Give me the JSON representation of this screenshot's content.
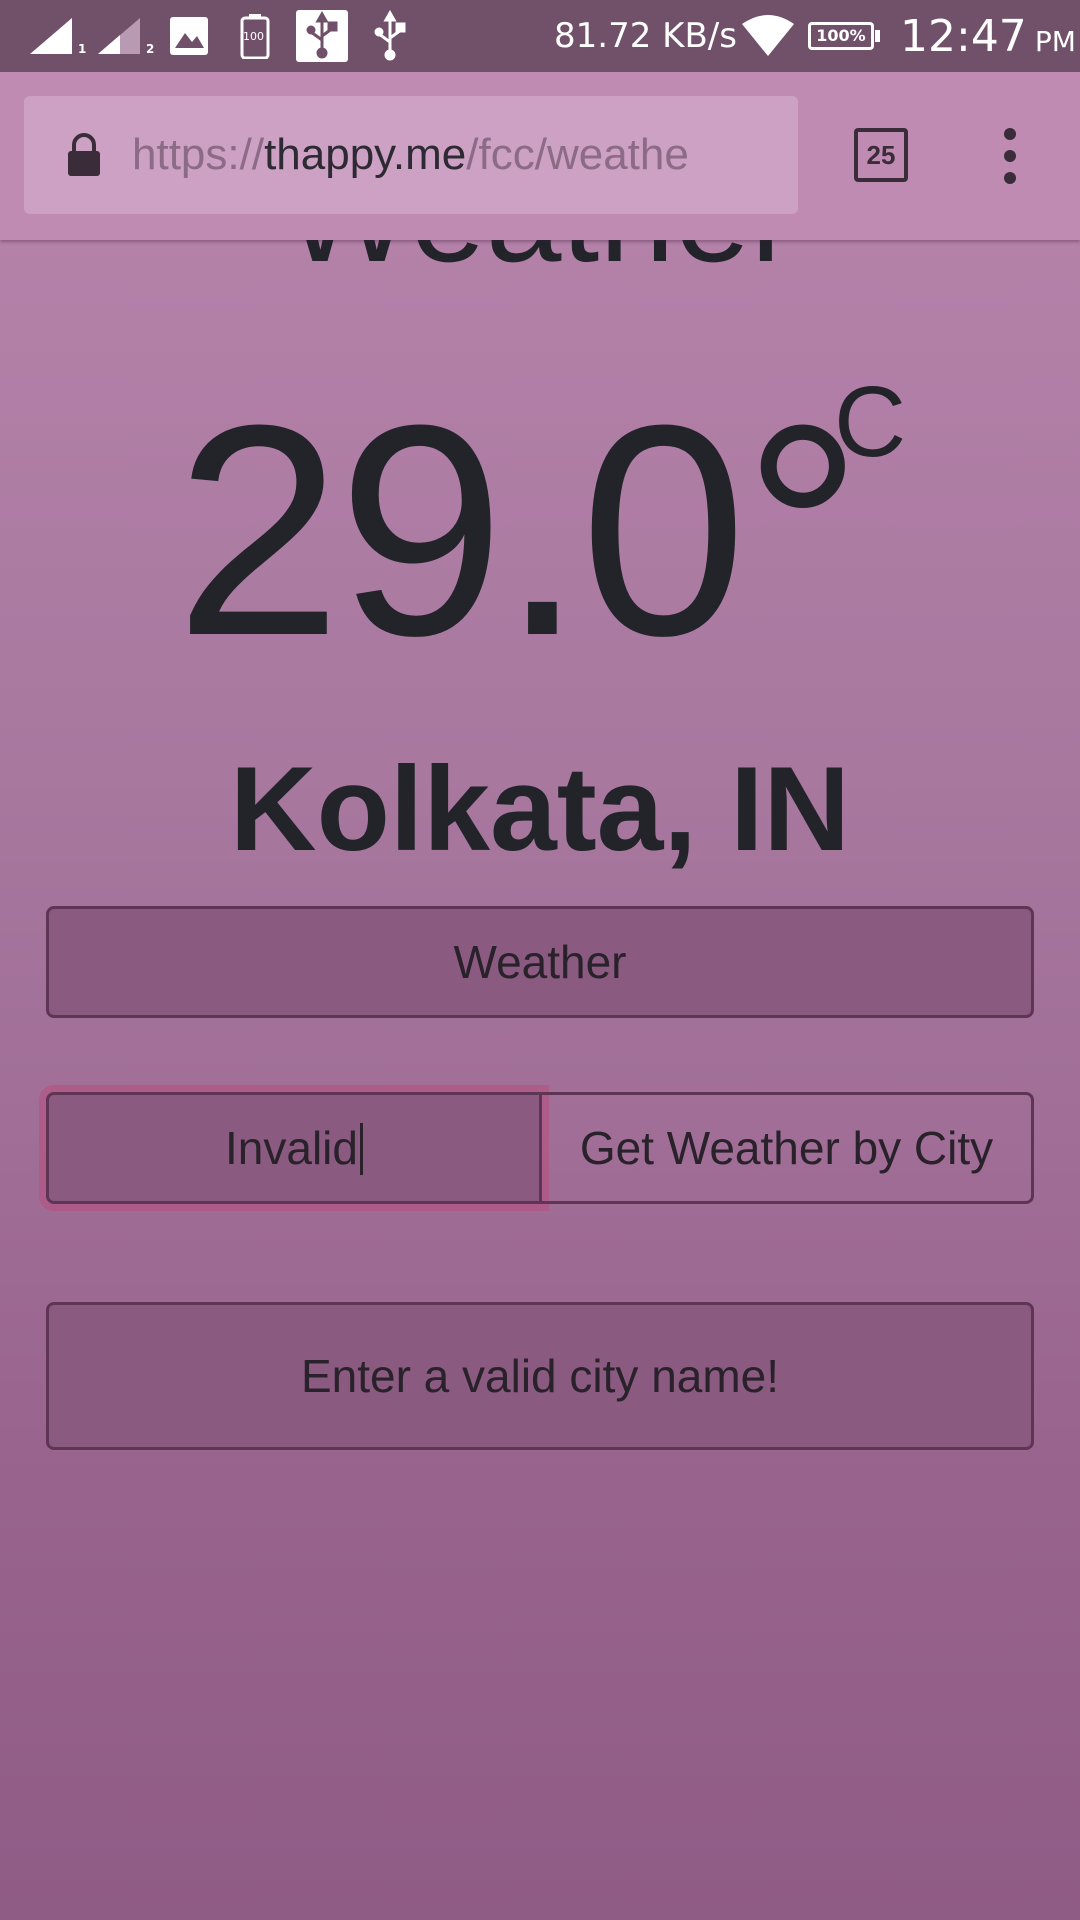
{
  "status_bar": {
    "sim1_label": "1",
    "sim2_label": "2",
    "battery_small_label": "100",
    "network_speed": "81.72 KB/s",
    "battery_percent": "100%",
    "time": "12:47",
    "ampm": "PM",
    "icons": [
      "signal-sim1-icon",
      "signal-sim2-icon",
      "gallery-icon",
      "battery-saver-icon",
      "usb-icon",
      "usb-icon",
      "wifi-icon",
      "battery-icon"
    ]
  },
  "browser": {
    "url_scheme": "https://",
    "url_host": "thappy.me",
    "url_path": "/fcc/weathe",
    "tab_count": "25",
    "icons": [
      "lock-icon",
      "tabs-icon",
      "more-vert-icon"
    ]
  },
  "page": {
    "heading": "Weather",
    "temperature": "29.0°",
    "unit": "C",
    "city": "Kolkata, IN",
    "weather_button": "Weather",
    "city_input_value": "Invalid",
    "get_city_button": "Get Weather by City",
    "message": "Enter a valid city name!"
  },
  "colors": {
    "status_bar": "#71516a",
    "toolbar": "#bf8bb2",
    "panel": "#8b5a80",
    "text": "#22242a"
  }
}
